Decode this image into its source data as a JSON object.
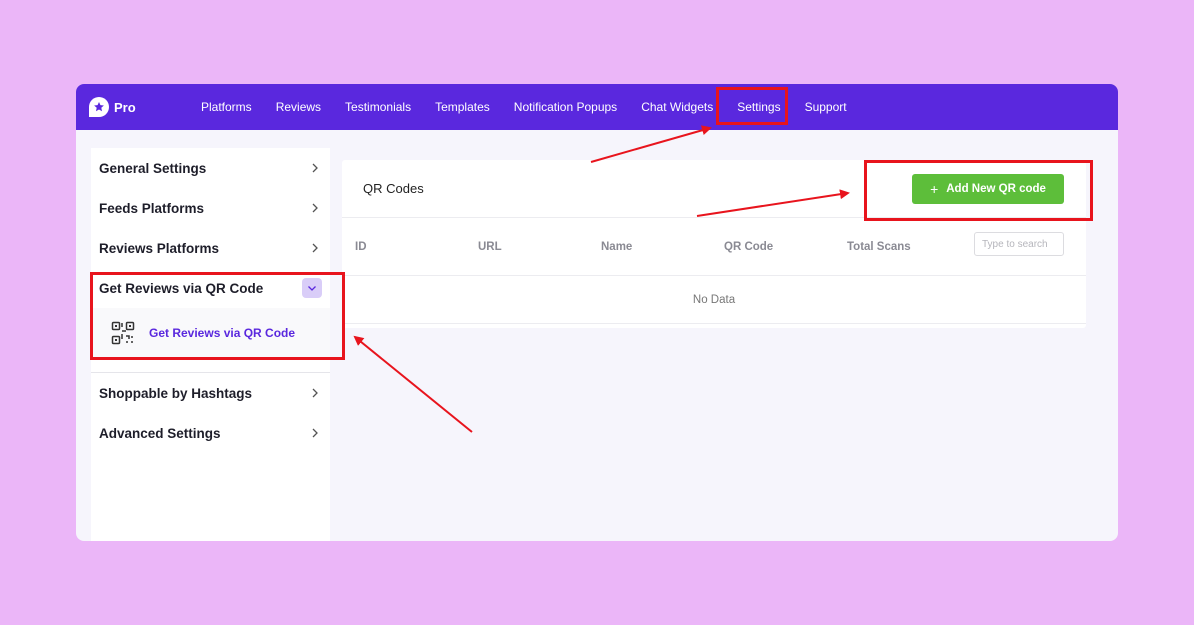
{
  "brand": {
    "name": "Pro",
    "icon": "star-chat-icon"
  },
  "nav": {
    "items": [
      {
        "label": "Platforms"
      },
      {
        "label": "Reviews"
      },
      {
        "label": "Testimonials"
      },
      {
        "label": "Templates"
      },
      {
        "label": "Notification Popups"
      },
      {
        "label": "Chat Widgets"
      },
      {
        "label": "Settings",
        "active": true
      },
      {
        "label": "Support"
      }
    ]
  },
  "sidebar": {
    "items": [
      {
        "label": "General Settings",
        "icon": "chevron-right-icon"
      },
      {
        "label": "Feeds Platforms",
        "icon": "chevron-right-icon"
      },
      {
        "label": "Reviews Platforms",
        "icon": "chevron-right-icon"
      },
      {
        "label": "Get Reviews via QR Code",
        "icon": "chevron-down-icon",
        "expanded": true
      },
      {
        "label": "Shoppable by Hashtags",
        "icon": "chevron-right-icon"
      },
      {
        "label": "Advanced Settings",
        "icon": "chevron-right-icon"
      }
    ],
    "subitem": {
      "label": "Get Reviews via QR Code",
      "icon": "qr-code-icon"
    }
  },
  "panel": {
    "title": "QR Codes",
    "add_button": "Add New QR code",
    "columns": [
      "ID",
      "URL",
      "Name",
      "QR Code",
      "Total Scans"
    ],
    "search_placeholder": "Type to search",
    "empty_text": "No Data"
  },
  "colors": {
    "background": "#ebb6f8",
    "topbar": "#5a28de",
    "accent": "#5a28de",
    "add_button": "#5dbe3a",
    "annotation": "#e8141d"
  }
}
